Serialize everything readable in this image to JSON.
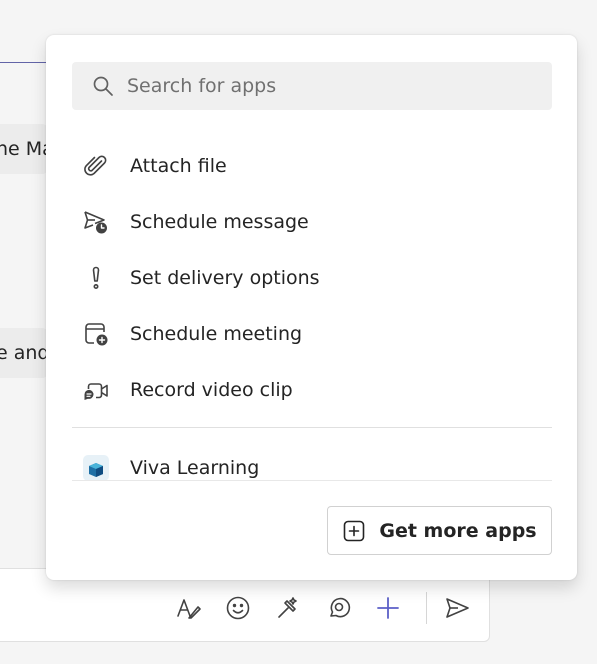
{
  "background": {
    "message_fragment_1": "ne Ma",
    "message_fragment_2": "e and"
  },
  "popup": {
    "search": {
      "placeholder": "Search for apps",
      "icon": "search-icon"
    },
    "actions": [
      {
        "label": "Attach file",
        "icon": "paperclip-icon"
      },
      {
        "label": "Schedule message",
        "icon": "schedule-send-icon"
      },
      {
        "label": "Set delivery options",
        "icon": "exclamation-icon"
      },
      {
        "label": "Schedule meeting",
        "icon": "calendar-add-icon"
      },
      {
        "label": "Record video clip",
        "icon": "video-clip-icon"
      }
    ],
    "apps": [
      {
        "label": "Viva Learning",
        "icon": "viva-learning-icon"
      }
    ],
    "get_more_apps": {
      "label": "Get more apps",
      "icon": "add-square-icon"
    }
  },
  "toolbar": {
    "buttons": [
      {
        "name": "format-icon"
      },
      {
        "name": "emoji-icon"
      },
      {
        "name": "copilot-icon"
      },
      {
        "name": "loop-icon"
      },
      {
        "name": "add-icon",
        "active": true
      },
      {
        "name": "send-icon"
      }
    ],
    "accent_color": "#5b5fc7"
  }
}
